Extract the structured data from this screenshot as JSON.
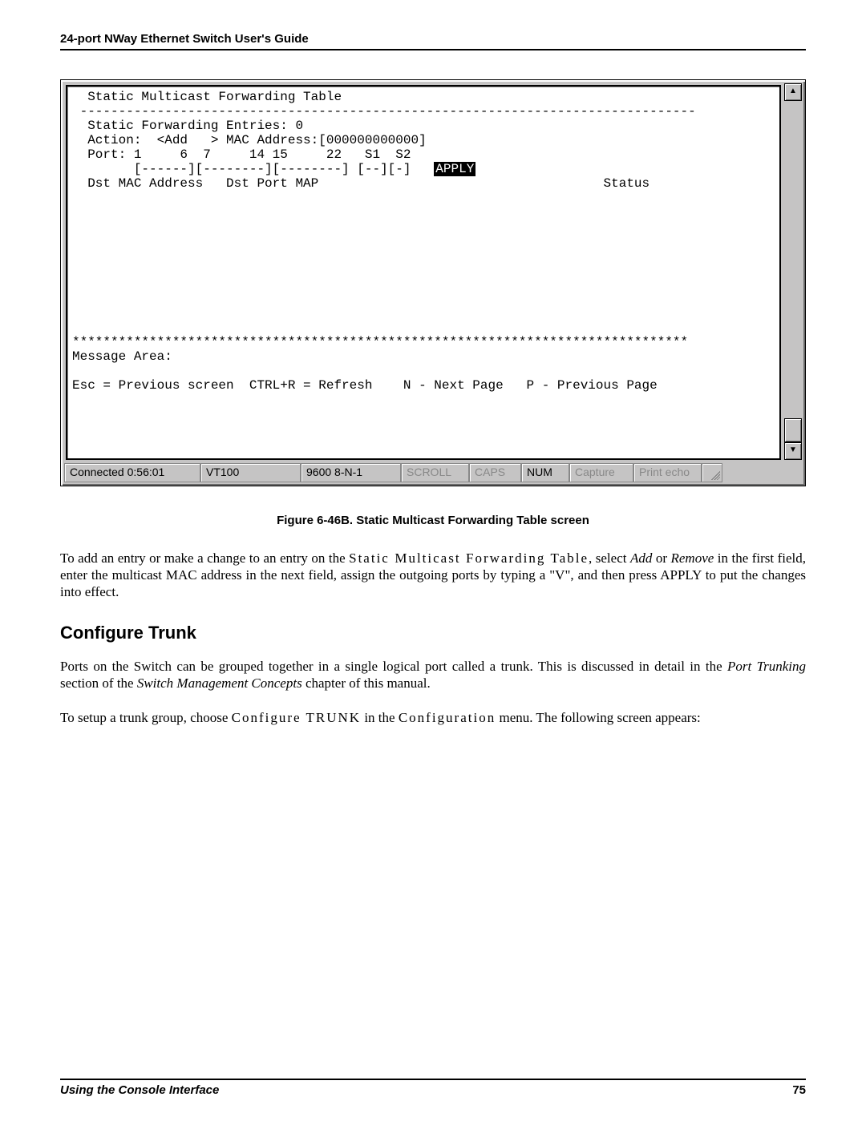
{
  "header": {
    "title": "24-port NWay Ethernet Switch User's Guide"
  },
  "terminal": {
    "title": "  Static Multicast Forwarding Table",
    "hr": " --------------------------------------------------------------------------------",
    "l1": "  Static Forwarding Entries: 0",
    "l2": "  Action:  <Add   > MAC Address:[000000000000]",
    "l3": "  Port: 1     6  7     14 15     22   S1  S2",
    "l4a": "        [------][--------][--------] [--][-]   ",
    "apply": "APPLY",
    "l5": "  Dst MAC Address   Dst Port MAP                                     Status",
    "stars": "********************************************************************************",
    "msg": "Message Area:",
    "help": "Esc = Previous screen  CTRL+R = Refresh    N - Next Page   P - Previous Page"
  },
  "statusbar": {
    "connected": "Connected 0:56:01",
    "emulation": "VT100",
    "speed": "9600 8-N-1",
    "scroll": "SCROLL",
    "caps": "CAPS",
    "num": "NUM",
    "capture": "Capture",
    "print": "Print echo"
  },
  "caption": "Figure 6-46B.  Static Multicast Forwarding Table screen",
  "para1": {
    "a": "To add an entry or make a change to an entry on the ",
    "b": "Static Multicast Forwarding Table",
    "c": ", select ",
    "d": "Add",
    "e": " or ",
    "f": "Remove",
    "g": " in the first field, enter the multicast MAC address in the next field, assign the outgoing ports by typing a \"V\", and then press APPLY to put the changes into effect."
  },
  "heading": "Configure Trunk",
  "para2": {
    "a": "Ports on the Switch can be grouped together in a single logical port called a trunk. This is discussed in detail in the ",
    "b": "Port Trunking",
    "c": " section of the ",
    "d": "Switch Management Concepts",
    "e": " chapter of this manual."
  },
  "para3": {
    "a": "To setup a trunk group, choose ",
    "b": "Configure TRUNK",
    "c": " in the ",
    "d": "Configuration",
    "e": " menu. The following screen appears:"
  },
  "footer": {
    "left": "Using the Console Interface",
    "right": "75"
  }
}
